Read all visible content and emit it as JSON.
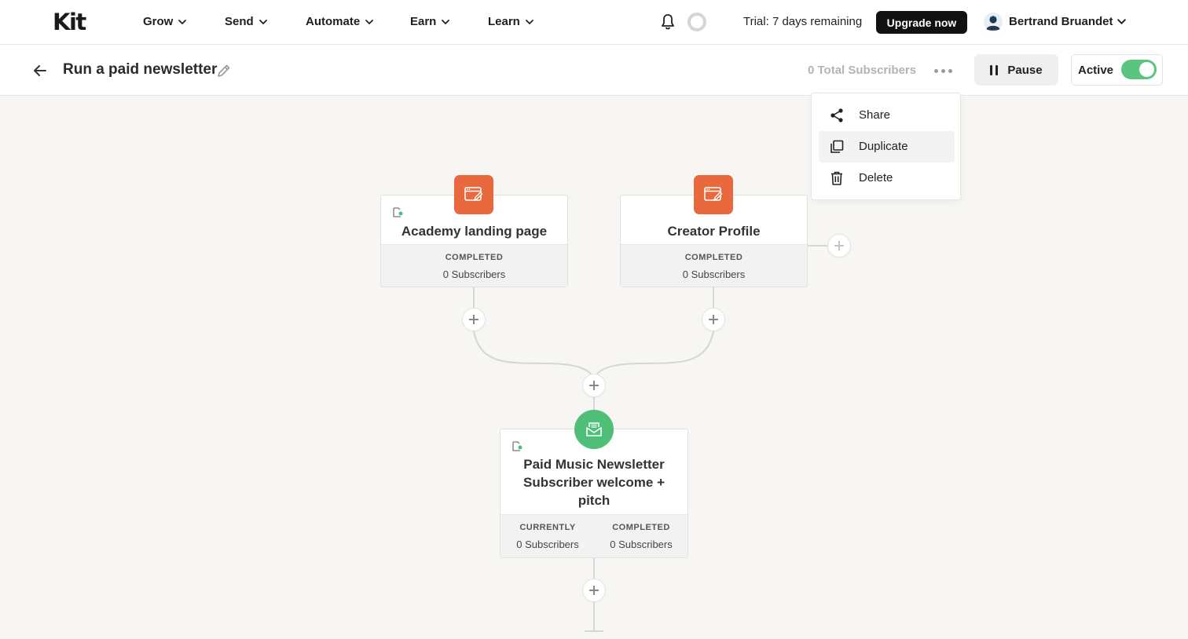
{
  "nav": {
    "logo": "Kit",
    "items": [
      {
        "label": "Grow"
      },
      {
        "label": "Send"
      },
      {
        "label": "Automate"
      },
      {
        "label": "Earn"
      },
      {
        "label": "Learn"
      }
    ],
    "trial_text": "Trial: 7 days remaining",
    "upgrade_label": "Upgrade now",
    "user_name": "Bertrand Bruandet"
  },
  "subheader": {
    "title": "Run a paid newsletter",
    "total_subscribers": "0 Total Subscribers",
    "pause_label": "Pause",
    "active_label": "Active",
    "active_on": true
  },
  "menu": {
    "items": [
      {
        "label": "Share",
        "icon": "share-icon"
      },
      {
        "label": "Duplicate",
        "icon": "duplicate-icon",
        "highlighted": true
      },
      {
        "label": "Delete",
        "icon": "trash-icon"
      }
    ]
  },
  "flow": {
    "entries": [
      {
        "name": "Academy landing page",
        "status_label": "COMPLETED",
        "status_value": "0 Subscribers",
        "icon": "form-icon"
      },
      {
        "name": "Creator Profile",
        "status_label": "COMPLETED",
        "status_value": "0 Subscribers",
        "icon": "form-icon"
      }
    ],
    "sequence": {
      "name_line1": "Paid Music Newsletter",
      "name_line2": "Subscriber welcome +",
      "name_line3": "pitch",
      "icon": "email-sequence-icon",
      "stats": [
        {
          "label": "CURRENTLY",
          "value": "0 Subscribers"
        },
        {
          "label": "COMPLETED",
          "value": "0 Subscribers"
        }
      ]
    }
  },
  "colors": {
    "accent_orange": "#e8693d",
    "accent_green": "#4fbf77",
    "toggle_green": "#5bc47e",
    "upgrade_bg": "#111111"
  }
}
